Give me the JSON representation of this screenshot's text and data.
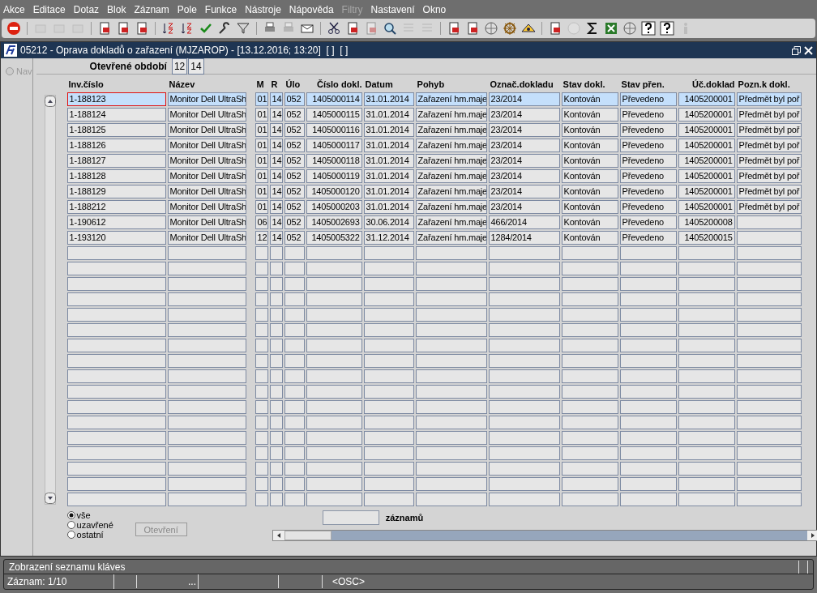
{
  "menu": [
    {
      "label": "Akce",
      "disabled": false
    },
    {
      "label": "Editace",
      "disabled": false
    },
    {
      "label": "Dotaz",
      "disabled": false
    },
    {
      "label": "Blok",
      "disabled": false
    },
    {
      "label": "Záznam",
      "disabled": false
    },
    {
      "label": "Pole",
      "disabled": false
    },
    {
      "label": "Funkce",
      "disabled": false
    },
    {
      "label": "Nástroje",
      "disabled": false
    },
    {
      "label": "Nápověda",
      "disabled": false
    },
    {
      "label": "Filtry",
      "disabled": true
    },
    {
      "label": "Nastavení",
      "disabled": false
    },
    {
      "label": "Okno",
      "disabled": false
    }
  ],
  "toolbar": [
    {
      "kind": "exit",
      "disabled": false
    },
    {
      "kind": "sep"
    },
    {
      "kind": "box",
      "disabled": true
    },
    {
      "kind": "box",
      "disabled": true
    },
    {
      "kind": "box",
      "disabled": true
    },
    {
      "kind": "sep"
    },
    {
      "kind": "doc",
      "disabled": false
    },
    {
      "kind": "doc",
      "disabled": false
    },
    {
      "kind": "doc",
      "disabled": false
    },
    {
      "kind": "sep"
    },
    {
      "kind": "sort",
      "disabled": false
    },
    {
      "kind": "sort",
      "disabled": false
    },
    {
      "kind": "check",
      "disabled": false
    },
    {
      "kind": "wrench",
      "disabled": false
    },
    {
      "kind": "filter",
      "disabled": false
    },
    {
      "kind": "sep"
    },
    {
      "kind": "printer",
      "disabled": false
    },
    {
      "kind": "printer",
      "disabled": true
    },
    {
      "kind": "envelope",
      "disabled": false
    },
    {
      "kind": "sep"
    },
    {
      "kind": "scissors",
      "disabled": false
    },
    {
      "kind": "doc",
      "disabled": false
    },
    {
      "kind": "doc",
      "disabled": true
    },
    {
      "kind": "search",
      "disabled": false
    },
    {
      "kind": "list",
      "disabled": true
    },
    {
      "kind": "list",
      "disabled": true
    },
    {
      "kind": "sep"
    },
    {
      "kind": "doc",
      "disabled": false
    },
    {
      "kind": "doc",
      "disabled": false
    },
    {
      "kind": "globe",
      "disabled": false
    },
    {
      "kind": "wheel",
      "disabled": false
    },
    {
      "kind": "eye",
      "disabled": false
    },
    {
      "kind": "sep"
    },
    {
      "kind": "doc",
      "disabled": false
    },
    {
      "kind": "clock",
      "disabled": true
    },
    {
      "kind": "sigma",
      "disabled": false
    },
    {
      "kind": "sheet",
      "disabled": false
    },
    {
      "kind": "globe",
      "disabled": false
    },
    {
      "kind": "help",
      "disabled": false
    },
    {
      "kind": "help",
      "disabled": false
    },
    {
      "kind": "info",
      "disabled": true
    }
  ],
  "window": {
    "title": "05212 - Oprava dokladů o zařazení (MJZAROP) - [13.12.2016; 13:20]  [ ]  [ ]"
  },
  "nav": {
    "label": "Nav",
    "disabled": true
  },
  "period": {
    "label": "Otevřené období",
    "month": "12",
    "year": "14"
  },
  "table": {
    "columns": [
      "Inv.číslo",
      "Název",
      "M",
      "R",
      "Úlo",
      "Číslo dokl.",
      "Datum",
      "Pohyb",
      "Označ.dokladu",
      "Stav dokl.",
      "Stav přen.",
      "Úč.doklad",
      "Pozn.k dokl."
    ],
    "rows": [
      {
        "selected": true,
        "cells": [
          "1-188123",
          "Monitor Dell UltraSh",
          "01",
          "14",
          "052",
          "1405000114",
          "31.01.2014",
          "Zařazení hm.maje",
          "23/2014",
          "Kontován",
          "Převedeno",
          "1405200001",
          "Předmět byl poř"
        ]
      },
      {
        "selected": false,
        "cells": [
          "1-188124",
          "Monitor Dell UltraSh",
          "01",
          "14",
          "052",
          "1405000115",
          "31.01.2014",
          "Zařazení hm.maje",
          "23/2014",
          "Kontován",
          "Převedeno",
          "1405200001",
          "Předmět byl poř"
        ]
      },
      {
        "selected": false,
        "cells": [
          "1-188125",
          "Monitor Dell UltraSh",
          "01",
          "14",
          "052",
          "1405000116",
          "31.01.2014",
          "Zařazení hm.maje",
          "23/2014",
          "Kontován",
          "Převedeno",
          "1405200001",
          "Předmět byl poř"
        ]
      },
      {
        "selected": false,
        "cells": [
          "1-188126",
          "Monitor Dell UltraSh",
          "01",
          "14",
          "052",
          "1405000117",
          "31.01.2014",
          "Zařazení hm.maje",
          "23/2014",
          "Kontován",
          "Převedeno",
          "1405200001",
          "Předmět byl poř"
        ]
      },
      {
        "selected": false,
        "cells": [
          "1-188127",
          "Monitor Dell UltraSh",
          "01",
          "14",
          "052",
          "1405000118",
          "31.01.2014",
          "Zařazení hm.maje",
          "23/2014",
          "Kontován",
          "Převedeno",
          "1405200001",
          "Předmět byl poř"
        ]
      },
      {
        "selected": false,
        "cells": [
          "1-188128",
          "Monitor Dell UltraSh",
          "01",
          "14",
          "052",
          "1405000119",
          "31.01.2014",
          "Zařazení hm.maje",
          "23/2014",
          "Kontován",
          "Převedeno",
          "1405200001",
          "Předmět byl poř"
        ]
      },
      {
        "selected": false,
        "cells": [
          "1-188129",
          "Monitor Dell UltraSh",
          "01",
          "14",
          "052",
          "1405000120",
          "31.01.2014",
          "Zařazení hm.maje",
          "23/2014",
          "Kontován",
          "Převedeno",
          "1405200001",
          "Předmět byl poř"
        ]
      },
      {
        "selected": false,
        "cells": [
          "1-188212",
          "Monitor Dell UltraSh",
          "01",
          "14",
          "052",
          "1405000203",
          "31.01.2014",
          "Zařazení hm.maje",
          "23/2014",
          "Kontován",
          "Převedeno",
          "1405200001",
          "Předmět byl poř"
        ]
      },
      {
        "selected": false,
        "cells": [
          "1-190612",
          "Monitor Dell UltraSh",
          "06",
          "14",
          "052",
          "1405002693",
          "30.06.2014",
          "Zařazení hm.maje",
          "466/2014",
          "Kontován",
          "Převedeno",
          "1405200008",
          ""
        ]
      },
      {
        "selected": false,
        "cells": [
          "1-193120",
          "Monitor Dell UltraSh",
          "12",
          "14",
          "052",
          "1405005322",
          "31.12.2014",
          "Zařazení hm.maje",
          "1284/2014",
          "Kontován",
          "Převedeno",
          "1405200015",
          ""
        ]
      }
    ]
  },
  "filter": [
    {
      "label": "vše",
      "selected": true
    },
    {
      "label": "uzavřené",
      "selected": false
    },
    {
      "label": "ostatní",
      "selected": false
    }
  ],
  "open_button": {
    "label": "Otevření",
    "disabled": true
  },
  "records": {
    "label": "záznamů"
  },
  "status": {
    "message": "Zobrazení seznamu kláves",
    "record": "Záznam: 1/10",
    "dots": "...",
    "mode": "<OSC>"
  }
}
